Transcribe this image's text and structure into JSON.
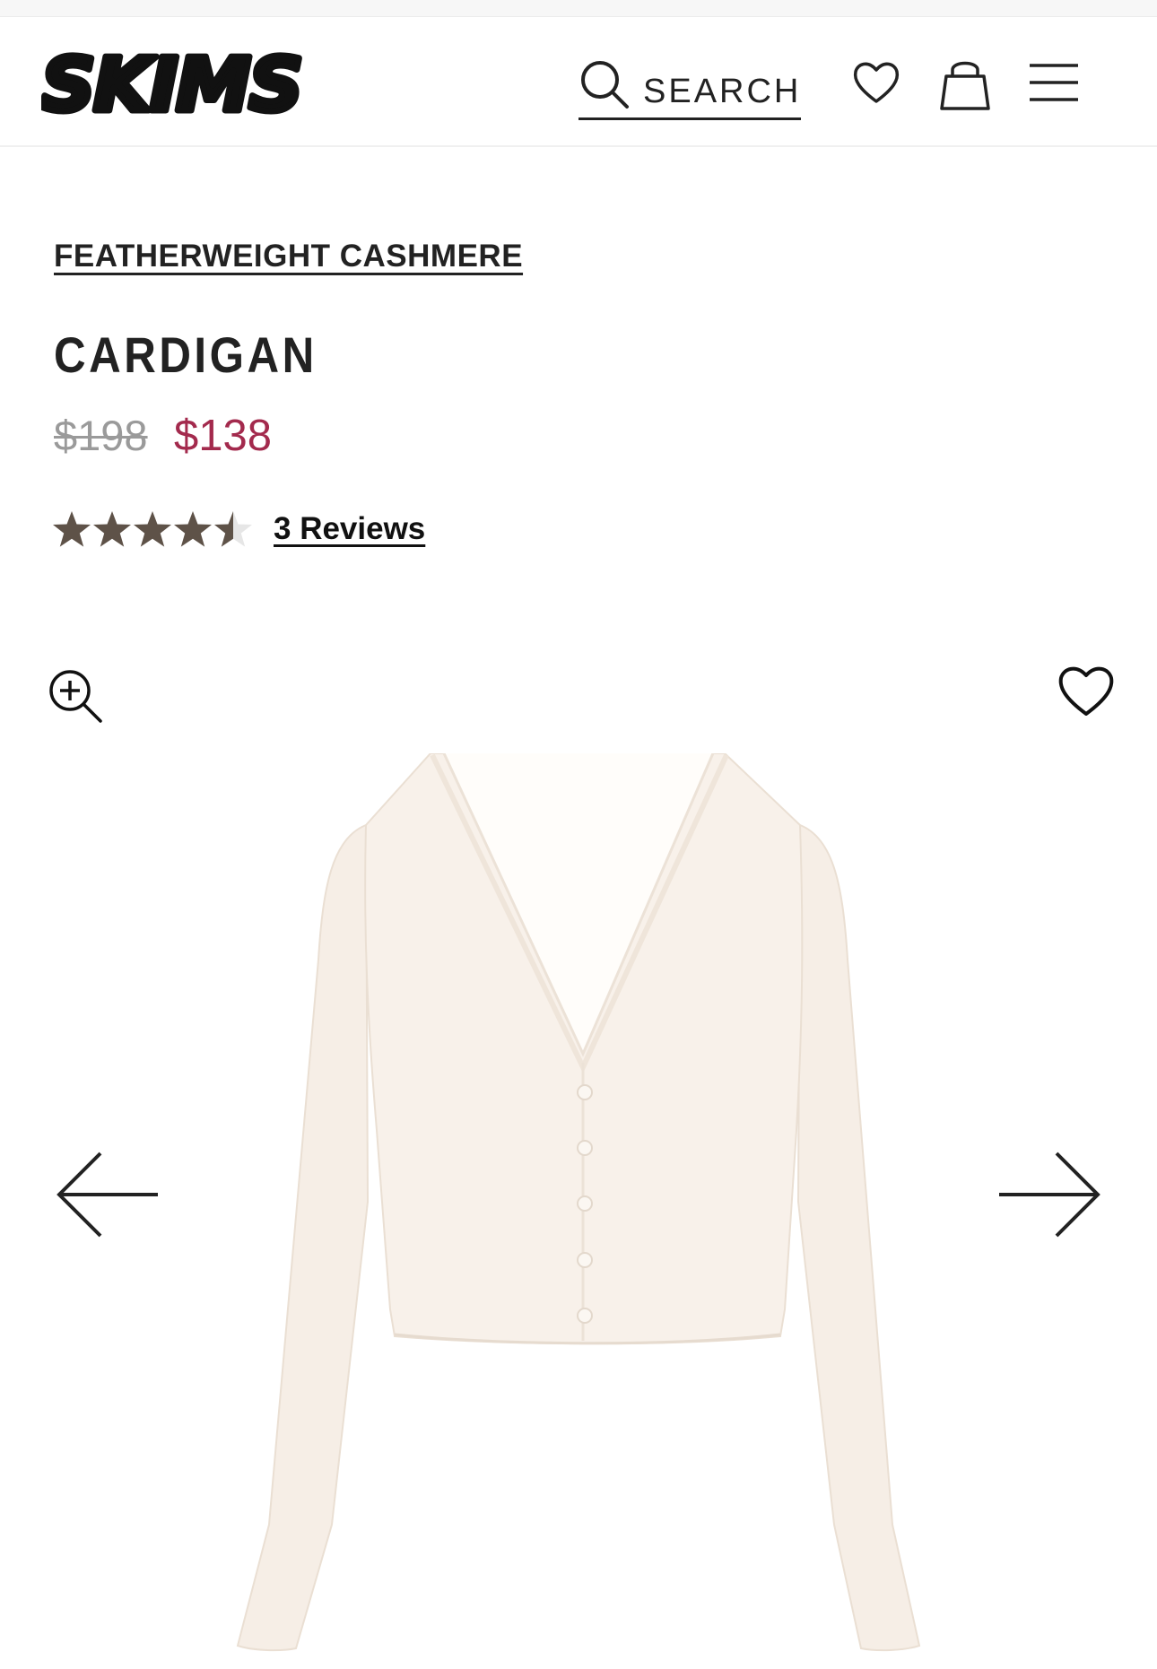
{
  "header": {
    "logo_text": "SKIMS",
    "search_label": "SEARCH",
    "icons": [
      "search-icon",
      "heart-icon",
      "shopping-bag-icon",
      "menu-icon"
    ]
  },
  "product": {
    "collection": "FEATHERWEIGHT CASHMERE",
    "title": "CARDIGAN",
    "original_price": "$198",
    "sale_price": "$138",
    "rating": 4.5,
    "rating_max": 5,
    "reviews_label": "3 Reviews"
  },
  "gallery": {
    "icons": [
      "zoom-in-icon",
      "heart-icon",
      "arrow-left-icon",
      "arrow-right-icon"
    ]
  },
  "colors": {
    "text": "#222222",
    "sale_price": "#a32a4d",
    "original_price": "#9a9a9a",
    "star_filled": "#5e5248",
    "star_empty": "#e6e6e6",
    "garment": "#f6eee6"
  }
}
